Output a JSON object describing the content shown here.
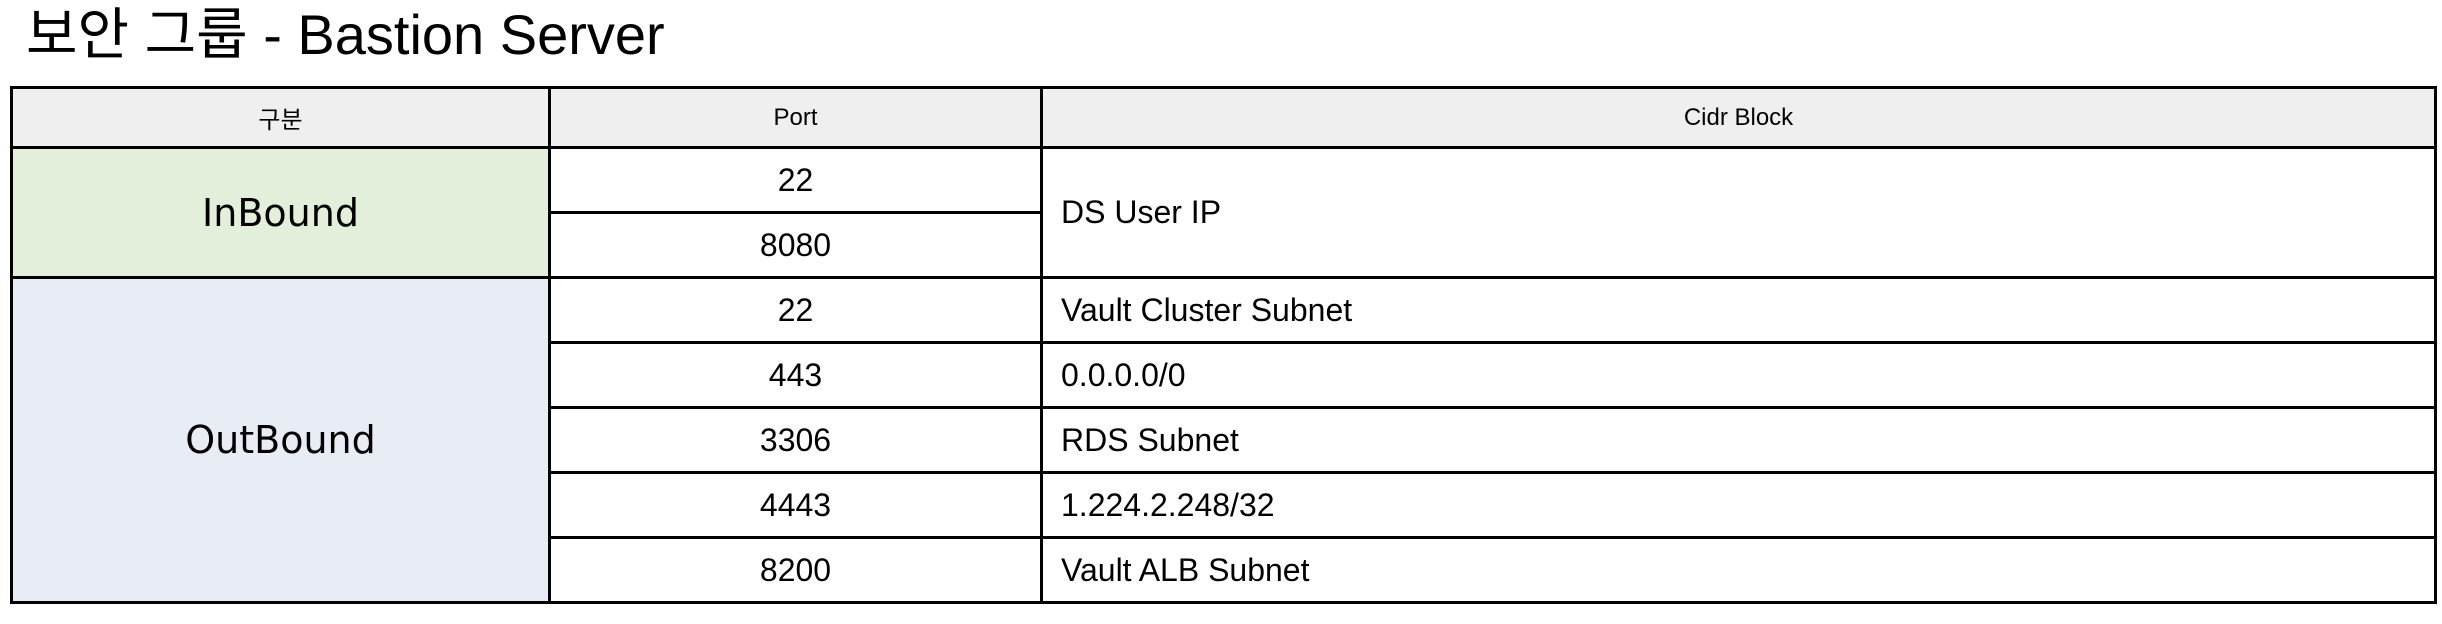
{
  "title": "보안 그룹 - Bastion Server",
  "table": {
    "headers": {
      "kind": "구분",
      "port": "Port",
      "cidr": "Cidr Block"
    },
    "inbound": {
      "label": "InBound",
      "rows": [
        {
          "port": "22"
        },
        {
          "port": "8080"
        }
      ],
      "cidr": "DS User IP"
    },
    "outbound": {
      "label": "OutBound",
      "rows": [
        {
          "port": "22",
          "cidr": "Vault Cluster Subnet"
        },
        {
          "port": "443",
          "cidr": "0.0.0.0/0"
        },
        {
          "port": "3306",
          "cidr": "RDS Subnet"
        },
        {
          "port": "4443",
          "cidr": "1.224.2.248/32"
        },
        {
          "port": "8200",
          "cidr": "Vault ALB Subnet"
        }
      ]
    }
  },
  "colors": {
    "header_bg": "#efefef",
    "inbound_bg": "#e3efdb",
    "outbound_bg": "#e8edf5",
    "border": "#000000"
  }
}
